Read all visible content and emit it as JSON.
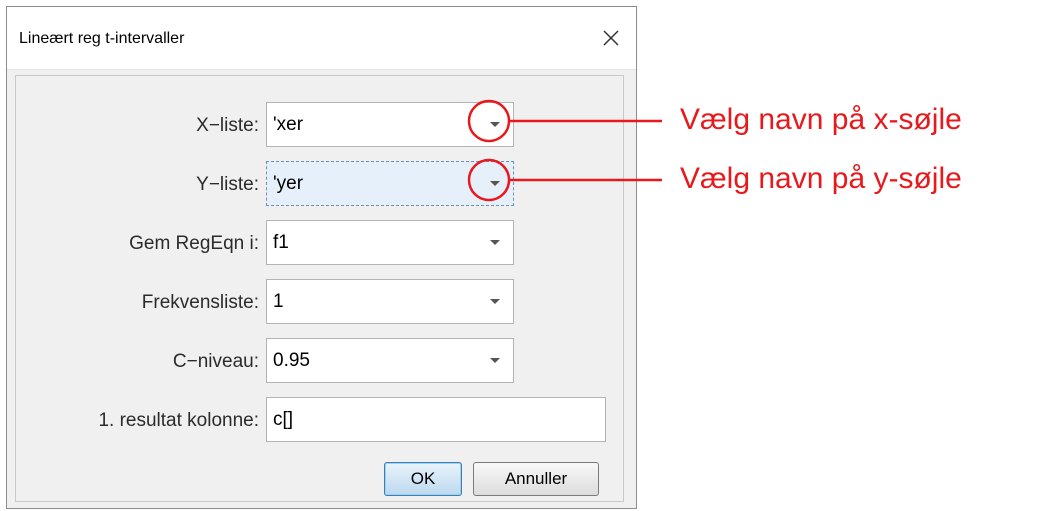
{
  "dialog": {
    "title": "Lineært reg t-intervaller",
    "fields": [
      {
        "label": "X−liste:",
        "value": "'xer"
      },
      {
        "label": "Y−liste:",
        "value": "'yer"
      },
      {
        "label": "Gem RegEqn i:",
        "value": "f1"
      },
      {
        "label": "Frekvensliste:",
        "value": "1"
      },
      {
        "label": "C−niveau:",
        "value": "0.95"
      },
      {
        "label": "1. resultat kolonne:",
        "value": "c[]"
      }
    ],
    "ok_label": "OK",
    "cancel_label": "Annuller"
  },
  "annotations": [
    {
      "text": "Vælg navn på x-søjle"
    },
    {
      "text": "Vælg navn på y-søjle"
    }
  ],
  "colors": {
    "annotation": "#e8191c",
    "dialog_bg": "#f0f0f0",
    "focus_bg": "#e6f0fb"
  }
}
